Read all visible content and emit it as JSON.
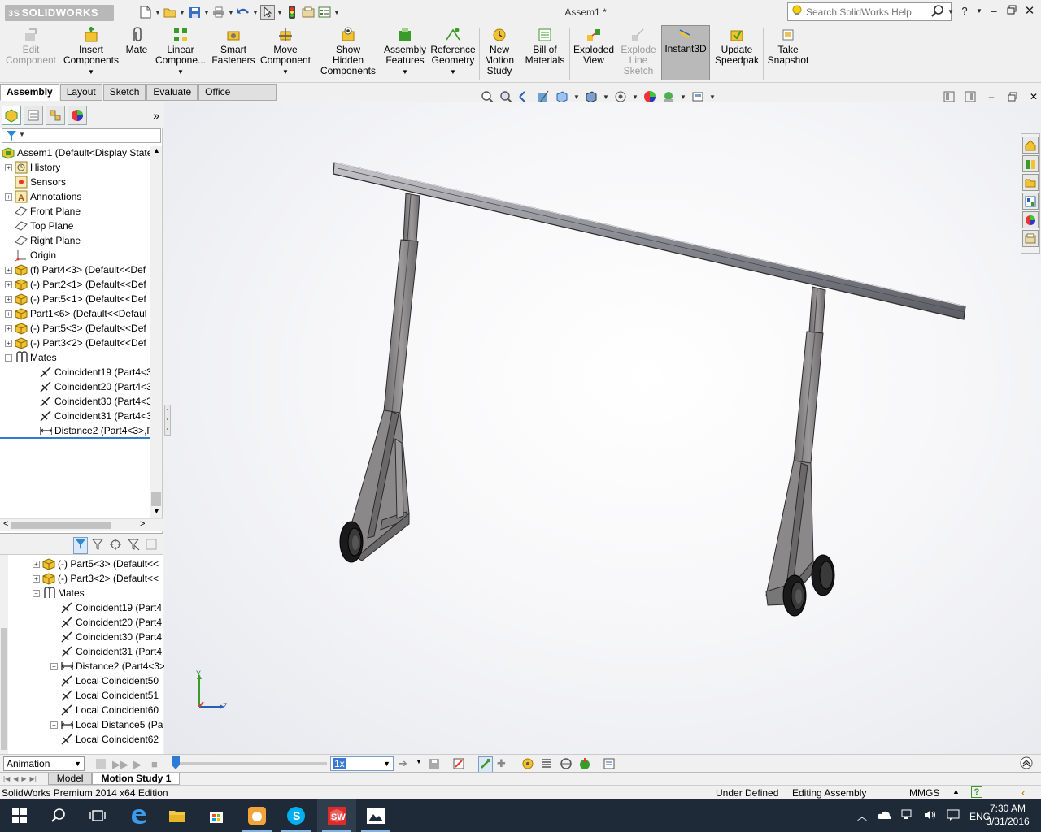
{
  "app": {
    "logo_text": "SOLIDWORKS",
    "logo_prefix": "3S",
    "document_title": "Assem1 *",
    "search_placeholder": "Search SolidWorks Help"
  },
  "command_manager": {
    "items": [
      {
        "label": "Edit\nComponent",
        "state": "disabled"
      },
      {
        "label": "Insert\nComponents",
        "state": "normal"
      },
      {
        "label": "Mate",
        "state": "normal"
      },
      {
        "label": "Linear\nCompone...",
        "state": "normal"
      },
      {
        "label": "Smart\nFasteners",
        "state": "normal"
      },
      {
        "label": "Move\nComponent",
        "state": "normal"
      },
      {
        "label": "Show\nHidden\nComponents",
        "state": "normal"
      },
      {
        "label": "Assembly\nFeatures",
        "state": "normal"
      },
      {
        "label": "Reference\nGeometry",
        "state": "normal"
      },
      {
        "label": "New\nMotion\nStudy",
        "state": "normal"
      },
      {
        "label": "Bill of\nMaterials",
        "state": "normal"
      },
      {
        "label": "Exploded\nView",
        "state": "normal"
      },
      {
        "label": "Explode\nLine\nSketch",
        "state": "disabled"
      },
      {
        "label": "Instant3D",
        "state": "active"
      },
      {
        "label": "Update\nSpeedpak",
        "state": "normal"
      },
      {
        "label": "Take\nSnapshot",
        "state": "normal"
      }
    ]
  },
  "tabs": [
    "Assembly",
    "Layout",
    "Sketch",
    "Evaluate",
    "Office Products"
  ],
  "feature_tree": {
    "root": "Assem1  (Default<Display State",
    "items": [
      {
        "label": "History",
        "icon": "history-icon",
        "expand": "+"
      },
      {
        "label": "Sensors",
        "icon": "sensor-icon",
        "expand": ""
      },
      {
        "label": "Annotations",
        "icon": "annotation-icon",
        "expand": "+"
      },
      {
        "label": "Front Plane",
        "icon": "plane-icon",
        "expand": ""
      },
      {
        "label": "Top Plane",
        "icon": "plane-icon",
        "expand": ""
      },
      {
        "label": "Right Plane",
        "icon": "plane-icon",
        "expand": ""
      },
      {
        "label": "Origin",
        "icon": "origin-icon",
        "expand": ""
      },
      {
        "label": "(f) Part4<3> (Default<<Def",
        "icon": "part-icon",
        "expand": "+"
      },
      {
        "label": "(-) Part2<1> (Default<<Def",
        "icon": "part-icon",
        "expand": "+"
      },
      {
        "label": "(-) Part5<1> (Default<<Def",
        "icon": "part-icon",
        "expand": "+"
      },
      {
        "label": "Part1<6> (Default<<Defaul",
        "icon": "part-icon",
        "expand": "+"
      },
      {
        "label": "(-) Part5<3> (Default<<Def",
        "icon": "part-icon",
        "expand": "+"
      },
      {
        "label": "(-) Part3<2> (Default<<Def",
        "icon": "part-icon",
        "expand": "+"
      },
      {
        "label": "Mates",
        "icon": "mates-icon",
        "expand": "-"
      },
      {
        "label": "Coincident19 (Part4<3>",
        "icon": "coincident-icon",
        "expand": "",
        "indent": 1
      },
      {
        "label": "Coincident20 (Part4<3>",
        "icon": "coincident-icon",
        "expand": "",
        "indent": 1
      },
      {
        "label": "Coincident30 (Part4<3>",
        "icon": "coincident-icon",
        "expand": "",
        "indent": 1
      },
      {
        "label": "Coincident31 (Part4<3>",
        "icon": "coincident-icon",
        "expand": "",
        "indent": 1
      },
      {
        "label": "Distance2 (Part4<3>,Pa",
        "icon": "distance-icon",
        "expand": "",
        "indent": 1
      }
    ]
  },
  "motion_tree": {
    "items": [
      {
        "label": "(-) Part5<3> (Default<<",
        "icon": "part-icon",
        "expand": "+",
        "indent": 0
      },
      {
        "label": "(-) Part3<2> (Default<<",
        "icon": "part-icon",
        "expand": "+",
        "indent": 0
      },
      {
        "label": "Mates",
        "icon": "mates-icon",
        "expand": "-",
        "indent": 0
      },
      {
        "label": "Coincident19 (Part4",
        "icon": "coincident-icon",
        "expand": "",
        "indent": 1
      },
      {
        "label": "Coincident20 (Part4",
        "icon": "coincident-icon",
        "expand": "",
        "indent": 1
      },
      {
        "label": "Coincident30 (Part4",
        "icon": "coincident-icon",
        "expand": "",
        "indent": 1
      },
      {
        "label": "Coincident31 (Part4",
        "icon": "coincident-icon",
        "expand": "",
        "indent": 1
      },
      {
        "label": "Distance2 (Part4<3>",
        "icon": "distance-icon",
        "expand": "+",
        "indent": 1
      },
      {
        "label": "Local Coincident50",
        "icon": "coincident-icon",
        "expand": "",
        "indent": 1
      },
      {
        "label": "Local Coincident51",
        "icon": "coincident-icon",
        "expand": "",
        "indent": 1
      },
      {
        "label": "Local Coincident60",
        "icon": "coincident-icon",
        "expand": "",
        "indent": 1
      },
      {
        "label": "Local Distance5 (Pa",
        "icon": "distance-icon",
        "expand": "+",
        "indent": 1
      },
      {
        "label": "Local Coincident62",
        "icon": "coincident-icon",
        "expand": "",
        "indent": 1
      }
    ]
  },
  "triad": {
    "y": "Y",
    "z": "Z"
  },
  "motion": {
    "study_type": "Animation",
    "speed": "1x"
  },
  "bottom_tabs": [
    "Model",
    "Motion Study 1"
  ],
  "status": {
    "edition": "SolidWorks Premium 2014 x64 Edition",
    "definition": "Under Defined",
    "mode": "Editing Assembly",
    "units": "MMGS",
    "units_caret": "▲",
    "help": "?"
  },
  "taskbar": {
    "time": "7:30 AM",
    "date": "3/31/2016",
    "lang": "ENG"
  },
  "colors": {
    "accent": "#2d7bd4",
    "taskbar": "#1e2a38",
    "model_metal": "#8e8c8c"
  }
}
